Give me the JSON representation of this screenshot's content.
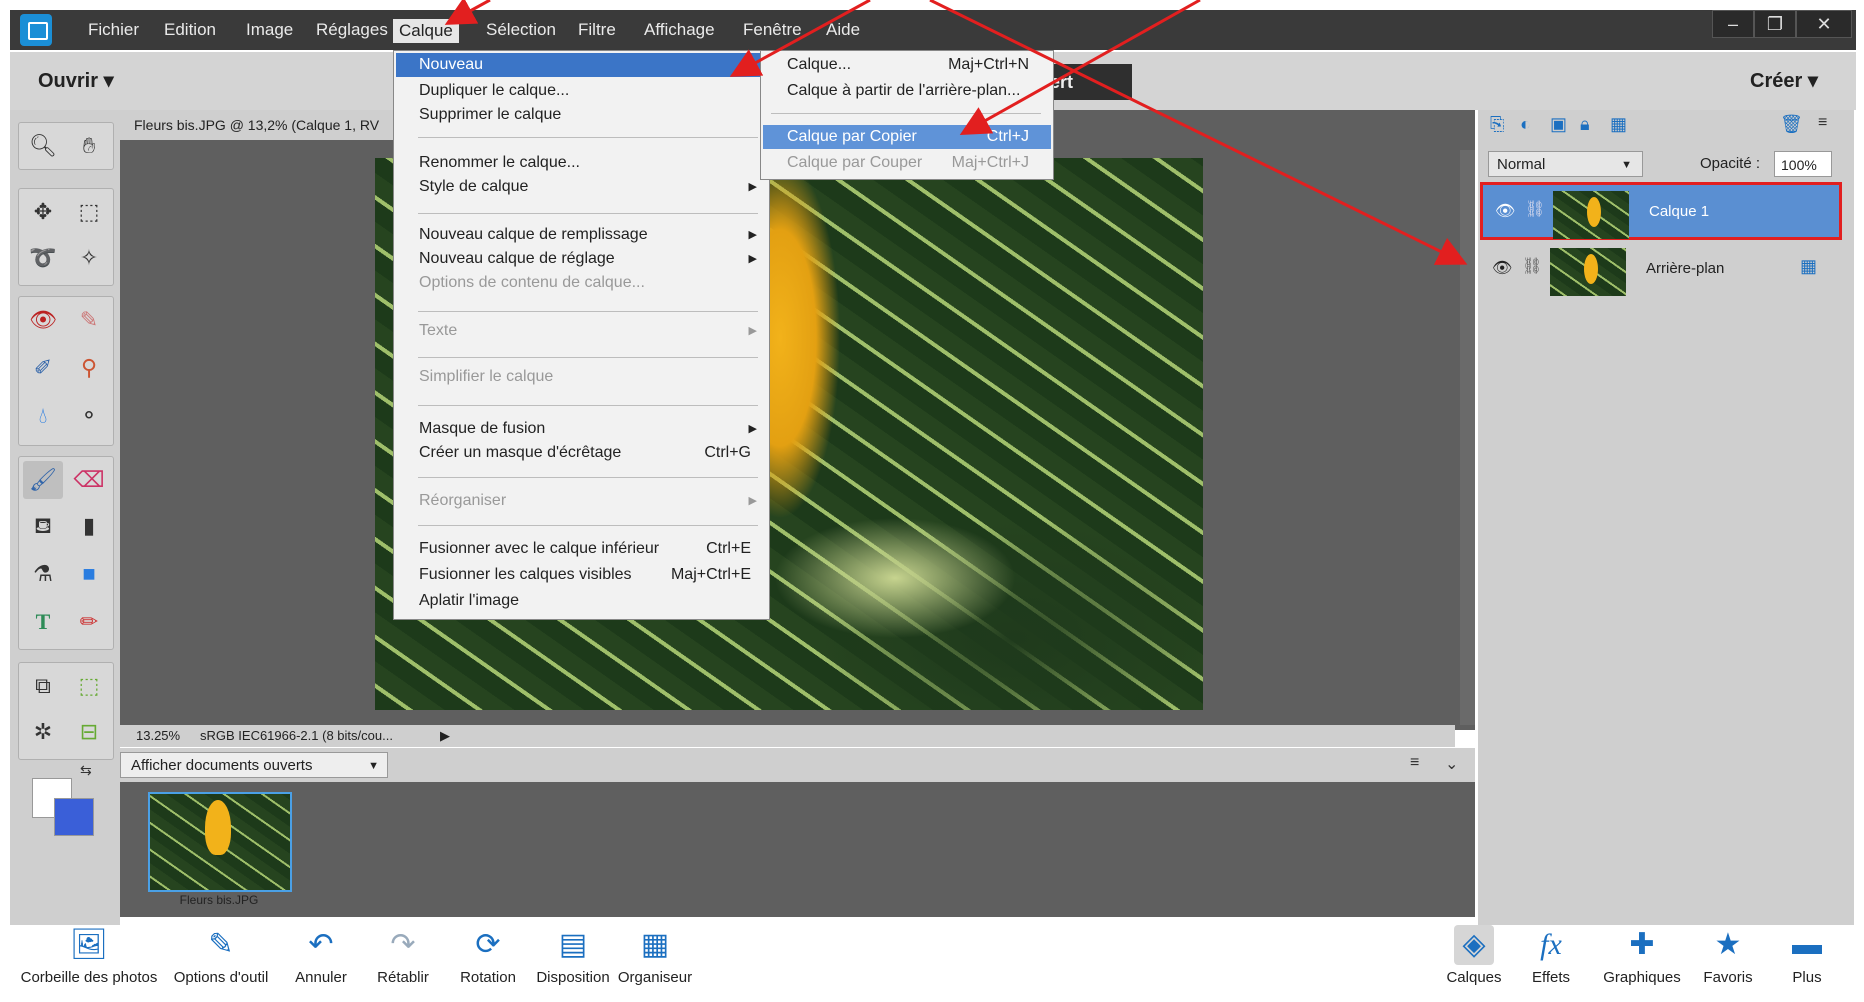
{
  "menubar": {
    "items": [
      "Fichier",
      "Edition",
      "Image",
      "Réglages",
      "Calque",
      "Sélection",
      "Filtre",
      "Affichage",
      "Fenêtre",
      "Aide"
    ],
    "active": "Calque"
  },
  "window_controls": {
    "minimize": "–",
    "restore": "❐",
    "close": "✕"
  },
  "actionbar": {
    "open_label": "Ouvrir",
    "mode_label": "ert",
    "create_label": "Créer"
  },
  "document": {
    "tab_title": "Fleurs bis.JPG @ 13,2% (Calque 1, RV",
    "zoom": "13.25%",
    "profile": "sRGB IEC61966-2.1 (8 bits/cou..."
  },
  "layer_menu": {
    "items": [
      {
        "label": "Nouveau",
        "state": "highlight",
        "arrow": false
      },
      {
        "label": "Dupliquer le calque..."
      },
      {
        "label": "Supprimer le calque"
      },
      {
        "label": "Renommer le calque..."
      },
      {
        "label": "Style de calque",
        "arrow": true
      },
      {
        "label": "Nouveau calque de remplissage",
        "arrow": true
      },
      {
        "label": "Nouveau calque de réglage",
        "arrow": true
      },
      {
        "label": "Options de contenu de calque...",
        "state": "disabled"
      },
      {
        "label": "Texte",
        "arrow": true,
        "state": "disabled"
      },
      {
        "label": "Simplifier le calque",
        "state": "disabled"
      },
      {
        "label": "Masque de fusion",
        "arrow": true
      },
      {
        "label": "Créer un masque d'écrêtage",
        "shortcut": "Ctrl+G"
      },
      {
        "label": "Réorganiser",
        "arrow": true,
        "state": "disabled"
      },
      {
        "label": "Fusionner avec le calque inférieur",
        "shortcut": "Ctrl+E"
      },
      {
        "label": "Fusionner les calques visibles",
        "shortcut": "Maj+Ctrl+E"
      },
      {
        "label": "Aplatir l'image"
      }
    ]
  },
  "new_submenu": {
    "items": [
      {
        "label": "Calque...",
        "shortcut": "Maj+Ctrl+N"
      },
      {
        "label": "Calque à partir de l'arrière-plan..."
      },
      {
        "label": "Calque par Copier",
        "shortcut": "Ctrl+J",
        "state": "highlight"
      },
      {
        "label": "Calque par Couper",
        "shortcut": "Maj+Ctrl+J",
        "state": "disabled"
      }
    ]
  },
  "photobin": {
    "select_value": "Afficher documents ouverts",
    "thumb_label": "Fleurs bis.JPG"
  },
  "layers_panel": {
    "blend_mode": "Normal",
    "opacity_label": "Opacité :",
    "opacity_value": "100%",
    "layers": [
      {
        "name": "Calque 1",
        "selected": true
      },
      {
        "name": "Arrière-plan",
        "selected": false
      }
    ]
  },
  "bottombar": {
    "left": [
      "Corbeille des photos",
      "Options d'outil",
      "Annuler",
      "Rétablir",
      "Rotation",
      "Disposition",
      "Organiseur"
    ],
    "right": [
      "Calques",
      "Effets",
      "Graphiques",
      "Favoris",
      "Plus"
    ]
  },
  "icons": {
    "left": [
      "photo-bin-icon",
      "tool-options-icon",
      "undo-icon",
      "redo-icon",
      "rotate-icon",
      "layout-icon",
      "organizer-icon"
    ],
    "right": [
      "layers-icon",
      "effects-icon",
      "graphics-icon",
      "favorites-icon",
      "more-icon"
    ]
  },
  "colors": {
    "menu_highlight": "#3b75c7",
    "annotation_red": "#e21f1f",
    "selected_layer": "#5a8fd2"
  }
}
